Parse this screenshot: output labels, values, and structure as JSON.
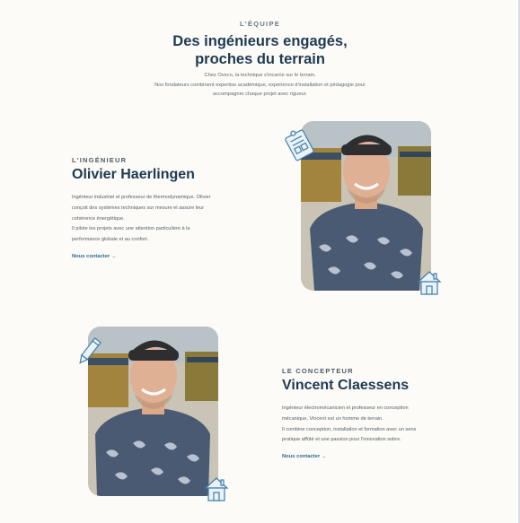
{
  "header": {
    "eyebrow": "L'ÉQUIPE",
    "title_line1": "Des ingénieurs engagés,",
    "title_line2": "proches du terrain",
    "intro_line1": "Chez Oveco, la technique s'incarne sur le terrain.",
    "intro_line2": "Nos fondateurs combinent expertise académique, expérience d'installation et pédagogie pour",
    "intro_line3": "accompagner chaque projet avec rigueur."
  },
  "engineer": {
    "eyebrow": "L'INGÉNIEUR",
    "name": "Olivier Haerlingen",
    "bio_line1": "Ingénieur industriel et professeur de thermodynamique. Olivier",
    "bio_line2": "conçoit des systèmes techniques sur mesure et assure leur",
    "bio_line3": "cohérence énergétique.",
    "bio_line4": "Il pilote les projets avec une attention particulière à la",
    "bio_line5": "performance globale et au confort.",
    "cta": "Nous contacter →"
  },
  "designer": {
    "eyebrow": "LE CONCEPTEUR",
    "name": "Vincent Claessens",
    "bio_line1": "Ingénieur électromécanicien et professeur en conception",
    "bio_line2": "mécanique, Vincent est un homme de terrain.",
    "bio_line3": "Il combine conception, installation et formation avec un sens",
    "bio_line4": "pratique affûté et une passion pour l'innovation sobre.",
    "cta": "Nous contacter →"
  },
  "colors": {
    "background": "#fcfbf7",
    "heading": "#1e3a52",
    "link": "#2b6a8a",
    "icon_stroke": "#3f7fa8"
  },
  "icons": [
    "blueprint-icon",
    "house-icon",
    "pencil-icon",
    "house-icon"
  ]
}
